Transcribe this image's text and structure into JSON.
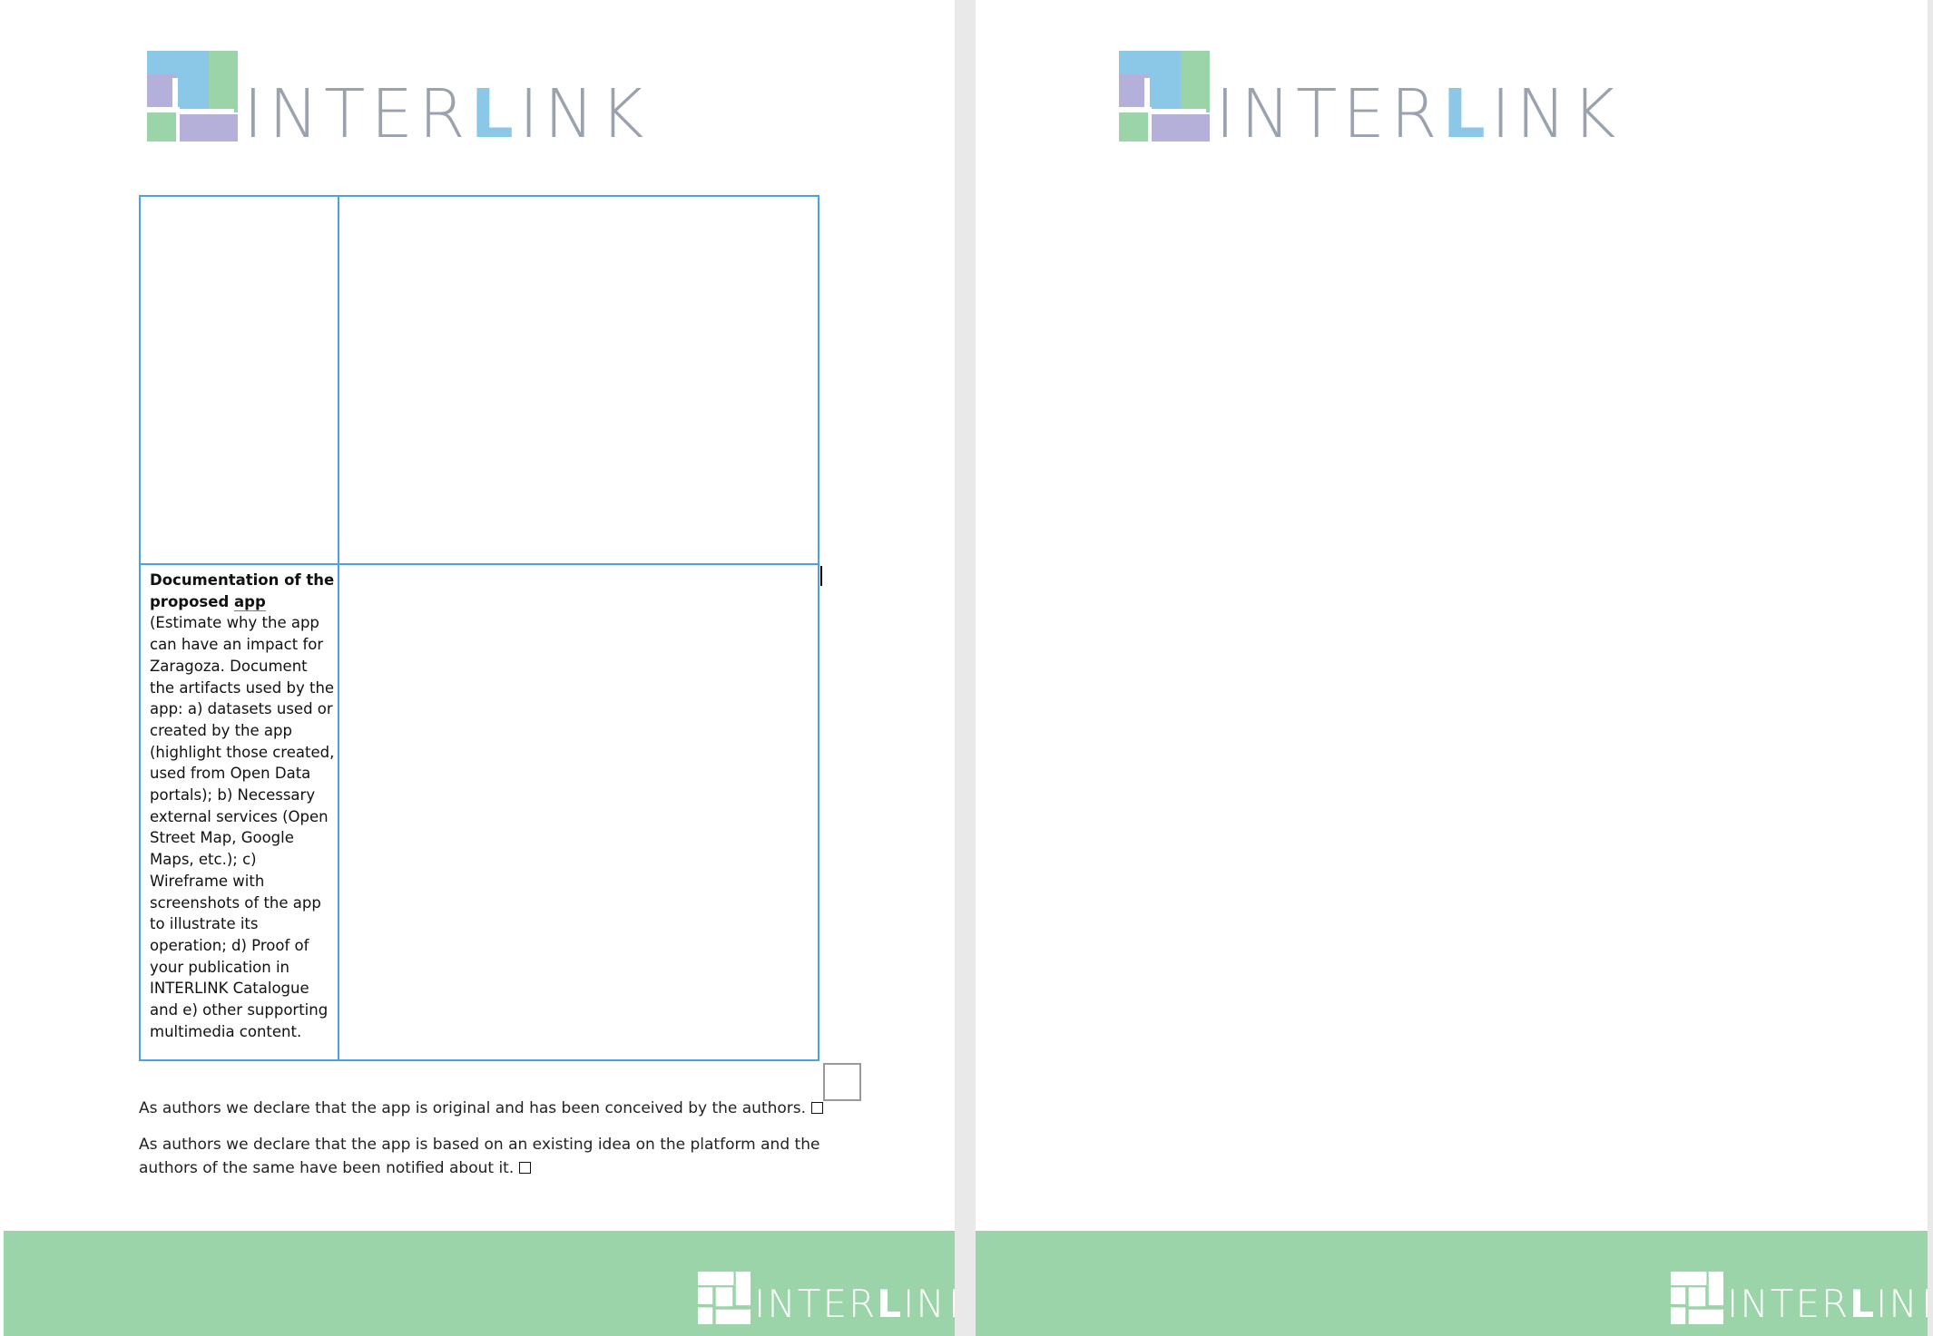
{
  "brand": {
    "name_part1": "INTER",
    "name_highlight": "L",
    "name_part2": "INK",
    "footer_part1": "INTER",
    "footer_highlight": "L",
    "footer_part2": "INK",
    "colors": {
      "blue": "#8bc7e6",
      "green": "#9bd4a9",
      "purple": "#b5b0d9",
      "gray": "#9aa3ad"
    }
  },
  "table": {
    "doc_label_bold_1": "Documentation of the proposed ",
    "doc_label_bold_2": "app",
    "doc_label_rest": " (Estimate why the app can have an impact for Zaragoza. Document the artifacts used by the app: a) datasets used or created by the app (highlight those created, used from Open Data portals); b) Necessary external services (Open Street Map, Google Maps, etc.); c) Wireframe with screenshots of the app to illustrate its operation; d) Proof of your publication in INTERLINK Catalogue and e) other supporting multimedia content."
  },
  "declarations": [
    "As authors we declare that the app is original and has been conceived by the authors.",
    "As authors we declare that the app is based on an existing idea on the platform and the authors of the same have been notified about it."
  ]
}
